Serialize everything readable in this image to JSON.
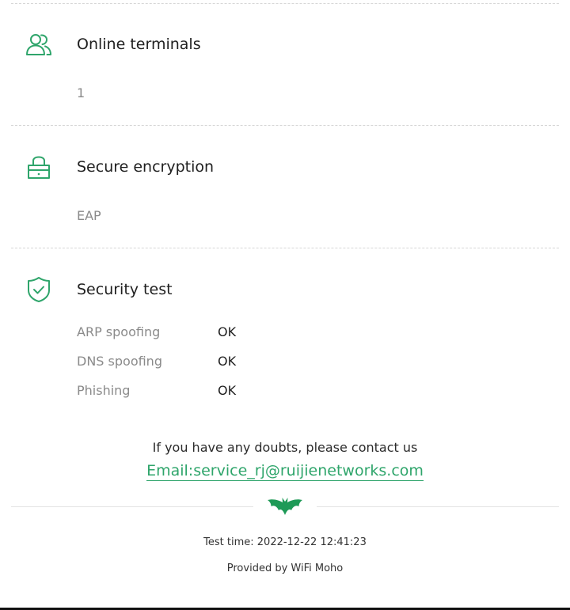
{
  "sections": [
    {
      "icon": "users-icon",
      "title": "Online terminals",
      "value": "1"
    },
    {
      "icon": "lock-icon",
      "title": "Secure encryption",
      "value": "EAP"
    },
    {
      "icon": "shield-check-icon",
      "title": "Security test"
    }
  ],
  "security_tests": [
    {
      "name": "ARP spoofing",
      "result": "OK"
    },
    {
      "name": "DNS spoofing",
      "result": "OK"
    },
    {
      "name": "Phishing",
      "result": "OK"
    }
  ],
  "contact": {
    "label": "If you have any doubts, please contact us",
    "email": "Email:service_rj@ruijienetworks.com"
  },
  "footer": {
    "logo_icon": "bat-logo-icon",
    "test_time": "Test time: 2022-12-22 12:41:23",
    "provided_by": "Provided by WiFi Moho"
  },
  "colors": {
    "accent": "#2fa56b",
    "muted_text": "#8a8a8a",
    "divider": "#d6d6d6"
  }
}
